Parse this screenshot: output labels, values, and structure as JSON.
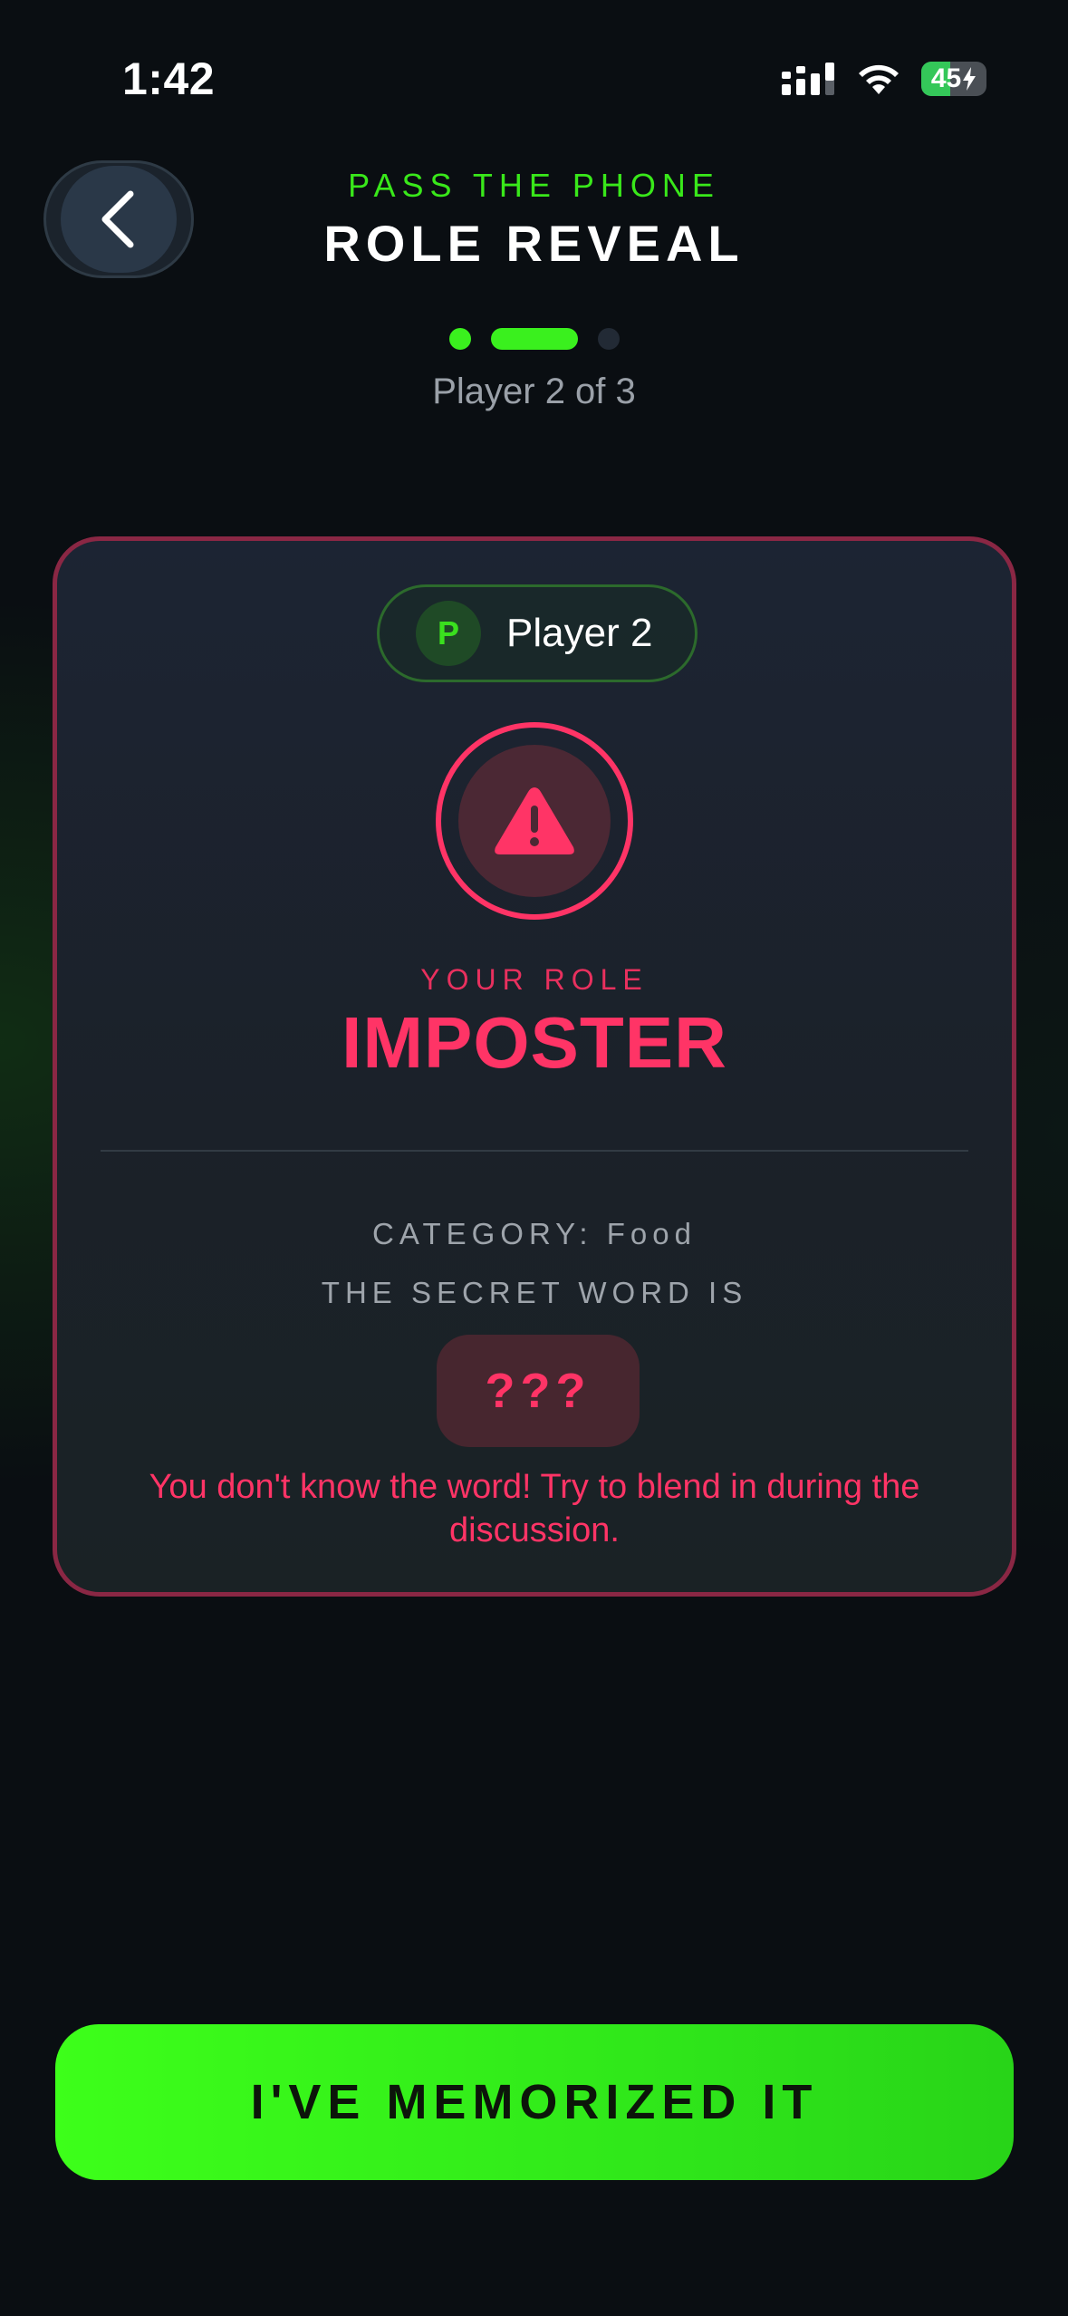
{
  "status_bar": {
    "time": "1:42",
    "battery_percent": 45,
    "battery_label": "45"
  },
  "header": {
    "back_icon": "chevron-left-icon",
    "kicker": "PASS THE PHONE",
    "title": "ROLE REVEAL",
    "progress": {
      "current": 2,
      "total": 3
    },
    "player_count": "Player 2 of 3"
  },
  "card": {
    "player_initial": "P",
    "player_name": "Player 2",
    "role_icon": "warning-triangle-icon",
    "role_kicker": "YOUR ROLE",
    "role_name": "IMPOSTER",
    "category": "CATEGORY: Food",
    "secret_label": "THE SECRET WORD IS",
    "secret_word": "???",
    "hint": "You don't know the word! Try to blend in during the discussion."
  },
  "cta": {
    "label": "I'VE MEMORIZED IT"
  },
  "colors": {
    "accent_green": "#3af01e",
    "imposter_red": "#ff3466",
    "card_border": "#8a2744",
    "background": "#0a0e12"
  }
}
